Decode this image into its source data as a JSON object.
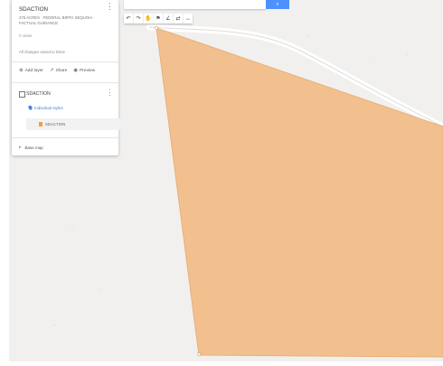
{
  "panel": {
    "title": "SDACTION",
    "subtitle": "275 ACRES · FEDERAL BIRTH SEQUOIA · FACTUAL GUIDANCE",
    "views": "0 views",
    "changes_note": "All changes saved to Drive",
    "actions": {
      "add_layer": "Add layer",
      "share": "Share",
      "preview": "Preview"
    },
    "layer": {
      "title": "SDACTION",
      "link_label": "Individual styles",
      "feature_label": "SDACTION"
    },
    "base_map_label": "Base map"
  },
  "toolbar": {
    "undo": "↶",
    "redo": "↷",
    "pan": "✋",
    "marker": "⚑",
    "line": "∠",
    "route": "⇄",
    "measure": "↔"
  },
  "search": {
    "placeholder": ""
  },
  "colors": {
    "polygon_fill": "#f2c08e",
    "polygon_stroke": "#e8b079",
    "map_background": "#f1f0ee",
    "road": "#ffffff",
    "accent": "#4d90fe"
  }
}
